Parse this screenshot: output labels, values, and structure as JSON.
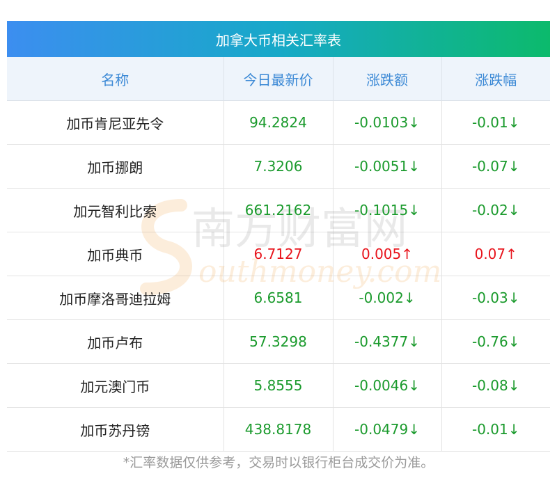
{
  "title": "加拿大币相关汇率表",
  "headers": [
    "名称",
    "今日最新价",
    "涨跌额",
    "涨跌幅"
  ],
  "rows": [
    {
      "name": "加币肯尼亚先令",
      "price": "94.2824",
      "change": "-0.0103↓",
      "pct": "-0.01↓",
      "dir": "down"
    },
    {
      "name": "加币挪朗",
      "price": "7.3206",
      "change": "-0.0051↓",
      "pct": "-0.07↓",
      "dir": "down"
    },
    {
      "name": "加元智利比索",
      "price": "661.2162",
      "change": "-0.1015↓",
      "pct": "-0.02↓",
      "dir": "down"
    },
    {
      "name": "加币典币",
      "price": "6.7127",
      "change": "0.005↑",
      "pct": "0.07↑",
      "dir": "up"
    },
    {
      "name": "加币摩洛哥迪拉姆",
      "price": "6.6581",
      "change": "-0.002↓",
      "pct": "-0.03↓",
      "dir": "down"
    },
    {
      "name": "加币卢布",
      "price": "57.3298",
      "change": "-0.4377↓",
      "pct": "-0.76↓",
      "dir": "down"
    },
    {
      "name": "加元澳门币",
      "price": "5.8555",
      "change": "-0.0046↓",
      "pct": "-0.08↓",
      "dir": "down"
    },
    {
      "name": "加币苏丹镑",
      "price": "438.8178",
      "change": "-0.0479↓",
      "pct": "-0.01↓",
      "dir": "down"
    }
  ],
  "footnote": "*汇率数据仅供参考，交易时以银行柜台成交价为准。",
  "watermark": {
    "cn": "南方财富网",
    "en": "outhmoney.com"
  },
  "colors": {
    "down": "#1a9a2c",
    "up": "#e8141c",
    "header_text": "#3d8ad6"
  }
}
